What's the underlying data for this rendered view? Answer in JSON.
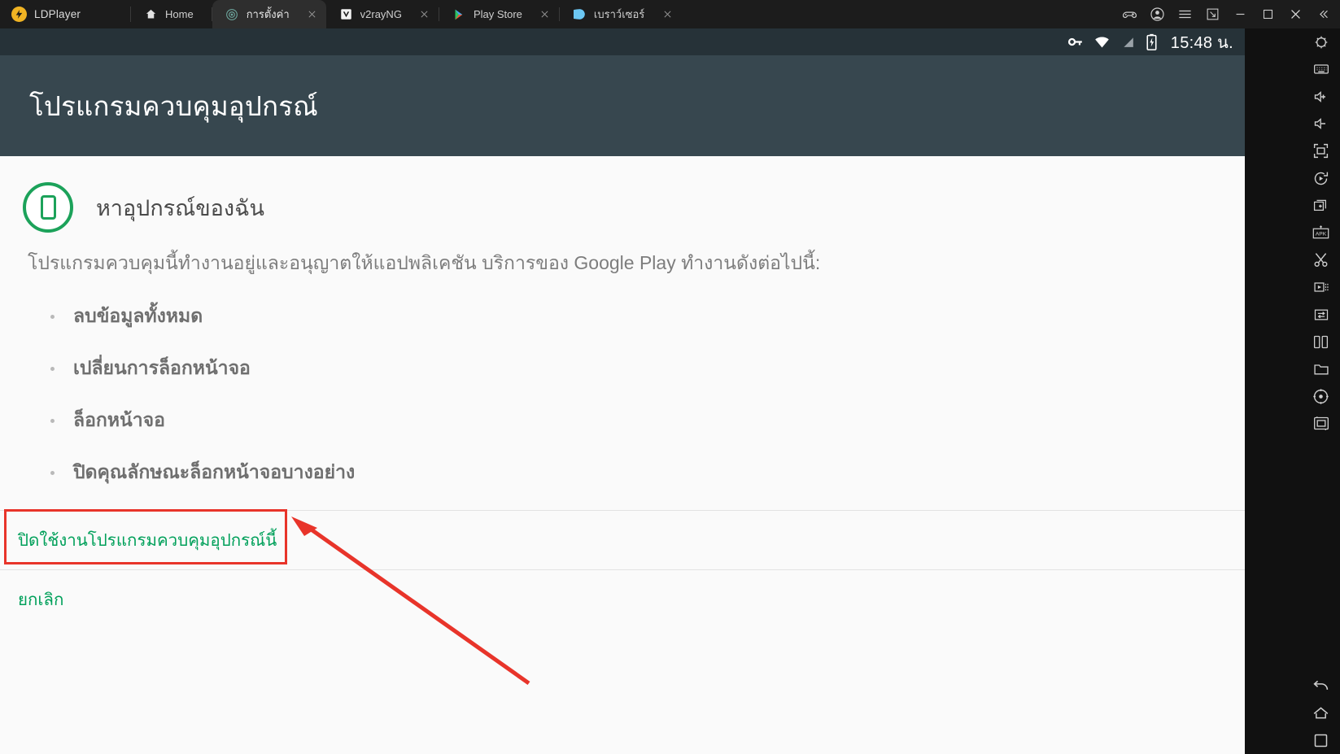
{
  "window": {
    "brand": "LDPlayer",
    "brand_logo_glyph": "ᗫ",
    "tabs": [
      {
        "label": "Home",
        "icon": "home-icon",
        "active": false,
        "closable": false
      },
      {
        "label": "การตั้งค่า",
        "icon": "settings-gear-icon",
        "active": true,
        "closable": true
      },
      {
        "label": "v2rayNG",
        "icon": "v2rayng-icon",
        "active": false,
        "closable": true
      },
      {
        "label": "Play Store",
        "icon": "play-store-icon",
        "active": false,
        "closable": true
      },
      {
        "label": "เบราว์เซอร์",
        "icon": "browser-globe-icon",
        "active": false,
        "closable": true
      }
    ],
    "controls": [
      {
        "name": "gamepad-icon",
        "title": "Gamepad"
      },
      {
        "name": "account-icon",
        "title": "Account"
      },
      {
        "name": "menu-icon",
        "title": "Menu"
      },
      {
        "name": "resize-icon",
        "title": "Resize"
      },
      {
        "name": "minimize-icon",
        "title": "Minimize"
      },
      {
        "name": "maximize-icon",
        "title": "Maximize"
      },
      {
        "name": "close-icon",
        "title": "Close"
      },
      {
        "name": "collapse-icon",
        "title": "Collapse"
      }
    ]
  },
  "statusbar": {
    "clock": "15:48 น.",
    "icons": [
      "vpn-key-icon",
      "wifi-icon",
      "signal-off-icon",
      "battery-charging-icon"
    ]
  },
  "screen": {
    "header_title": "โปรแกรมควบคุมอุปกรณ์",
    "admin_name": "หาอุปกรณ์ของฉัน",
    "admin_icon": "find-my-device-icon",
    "description": "โปรแกรมควบคุมนี้ทำงานอยู่และอนุญาตให้แอปพลิเคชัน บริการของ Google Play ทำงานดังต่อไปนี้:",
    "policies": [
      "ลบข้อมูลทั้งหมด",
      "เปลี่ยนการล็อกหน้าจอ",
      "ล็อกหน้าจอ",
      "ปิดคุณลักษณะล็อกหน้าจอบางอย่าง"
    ],
    "deactivate_label": "ปิดใช้งานโปรแกรมควบคุมอุปกรณ์นี้",
    "cancel_label": "ยกเลิก"
  },
  "annotation": {
    "highlight_color": "#e8342a",
    "arrow_color": "#e8342a"
  },
  "colors": {
    "accent_green": "#00a05a",
    "header_bg": "#37474f",
    "statusbar_bg": "#263238",
    "titlebar_bg": "#1c1c1c",
    "active_tab_bg": "#2e2e2e"
  },
  "sidebar": {
    "top_items": [
      "settings-gear-icon",
      "keyboard-icon",
      "volume-up-icon",
      "volume-down-icon",
      "fullscreen-icon",
      "rotate-icon",
      "new-window-icon",
      "install-apk-icon",
      "scissors-cut-icon",
      "video-record-icon",
      "file-transfer-icon",
      "multi-instance-icon",
      "folder-icon",
      "location-icon",
      "screenshot-icon"
    ],
    "bottom_items": [
      "back-icon",
      "home-icon",
      "recents-icon"
    ]
  }
}
